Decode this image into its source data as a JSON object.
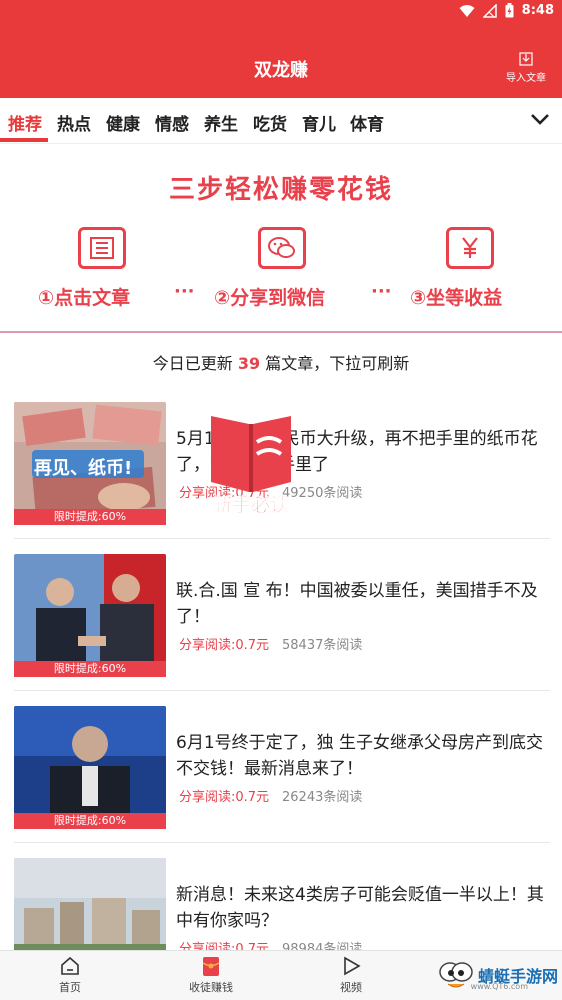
{
  "status_bar": {
    "time": "8:48"
  },
  "header": {
    "title": "双龙赚",
    "import_label": "导入文章"
  },
  "tabs": [
    "推荐",
    "热点",
    "健康",
    "情感",
    "养生",
    "吃货",
    "育儿",
    "体育"
  ],
  "banner": {
    "title": "三步轻松赚零花钱",
    "steps": [
      "①点击文章",
      "②分享到微信",
      "③坐等收益"
    ],
    "dots": "···"
  },
  "update_notice": {
    "prefix": "今日已更新",
    "count": "39",
    "suffix": "篇文章，下拉可刷新"
  },
  "thumb_tag": "限时提成:60%",
  "articles": [
    {
      "title": "5月1日起，人民币大升级，再不把手里的纸币花了，就要砸在手里了",
      "share": "分享阅读:0.7元",
      "reads": "49250条阅读",
      "thumb_caption": "再见、纸币!"
    },
    {
      "title": "联.合.国 宣 布！中国被委以重任，美国措手不及了！",
      "share": "分享阅读:0.7元",
      "reads": "58437条阅读"
    },
    {
      "title": "6月1号终于定了，独 生子女继承父母房产到底交不交钱！最新消息来了！",
      "share": "分享阅读:0.7元",
      "reads": "26243条阅读"
    },
    {
      "title": "新消息！未来这4类房子可能会贬值一半以上！其中有你家吗？",
      "share": "分享阅读:0.7元",
      "reads": "98984条阅读"
    }
  ],
  "float_badge": {
    "text": "新手必读"
  },
  "bottom_nav": [
    "首页",
    "收徒赚钱",
    "视频"
  ],
  "watermark": {
    "text": "蜻蜓手游网",
    "sub": "www.QT6.com"
  },
  "colors": {
    "brand": "#e83a3b",
    "accent": "#e8414b"
  }
}
